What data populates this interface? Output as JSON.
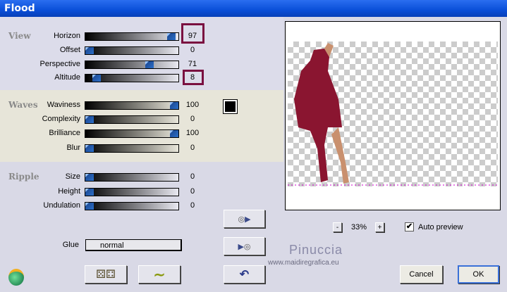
{
  "window": {
    "title": "Flood"
  },
  "view": {
    "label": "View",
    "sliders": [
      {
        "label": "Horizon",
        "value": "97",
        "pct": 97
      },
      {
        "label": "Offset",
        "value": "0",
        "pct": 0
      },
      {
        "label": "Perspective",
        "value": "71",
        "pct": 71
      },
      {
        "label": "Altitude",
        "value": "8",
        "pct": 8
      }
    ]
  },
  "waves": {
    "label": "Waves",
    "sliders": [
      {
        "label": "Waviness",
        "value": "100",
        "pct": 100
      },
      {
        "label": "Complexity",
        "value": "0",
        "pct": 0
      },
      {
        "label": "Brilliance",
        "value": "100",
        "pct": 100
      },
      {
        "label": "Blur",
        "value": "0",
        "pct": 0
      }
    ]
  },
  "ripple": {
    "label": "Ripple",
    "sliders": [
      {
        "label": "Size",
        "value": "0",
        "pct": 0
      },
      {
        "label": "Height",
        "value": "0",
        "pct": 0
      },
      {
        "label": "Undulation",
        "value": "0",
        "pct": 0
      }
    ]
  },
  "glue": {
    "label": "Glue",
    "value": "normal"
  },
  "zoom": {
    "minus": "-",
    "value": "33%",
    "plus": "+"
  },
  "auto_preview": {
    "label": "Auto preview",
    "checked": true
  },
  "watermark": {
    "name": "Pinuccia",
    "url": "www.maidiregrafica.eu"
  },
  "buttons": {
    "cancel": "Cancel",
    "ok": "OK"
  },
  "colors": {
    "highlight": "#7a1040",
    "title_bar": "#0a4fd8"
  }
}
